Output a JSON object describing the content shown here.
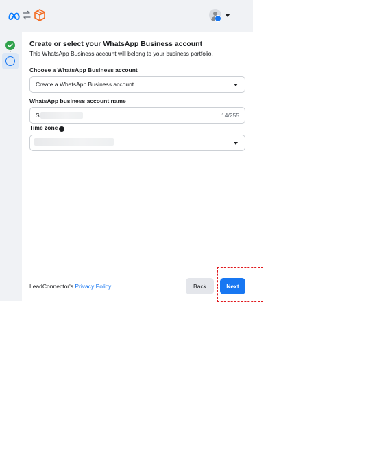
{
  "header": {
    "meta_logo_icon": "meta-logo-icon",
    "swap_icon": "swap-arrows-icon",
    "app_logo_icon": "orange-box-logo-icon",
    "account_icon": "avatar-with-facebook-badge"
  },
  "steps": [
    {
      "state": "completed",
      "icon": "check-circle-icon",
      "color": "#31a24c"
    },
    {
      "state": "current",
      "icon": "empty-circle-icon",
      "color": "#1877f2"
    }
  ],
  "main": {
    "title": "Create or select your WhatsApp Business account",
    "subtitle": "This WhatsApp Business account will belong to your business portfolio.",
    "account_select": {
      "label": "Choose a WhatsApp Business account",
      "value": "Create a WhatsApp Business account"
    },
    "account_name": {
      "label": "WhatsApp business account name",
      "value": "S",
      "counter": "14/255"
    },
    "time_zone": {
      "label": "Time zone",
      "info_icon": "i"
    }
  },
  "footer": {
    "text_prefix": "LeadConnector's ",
    "privacy_link": "Privacy Policy",
    "back_label": "Back",
    "next_label": "Next"
  },
  "colors": {
    "primary": "#1877f2",
    "success": "#31a24c",
    "highlight": "#e0191e"
  }
}
